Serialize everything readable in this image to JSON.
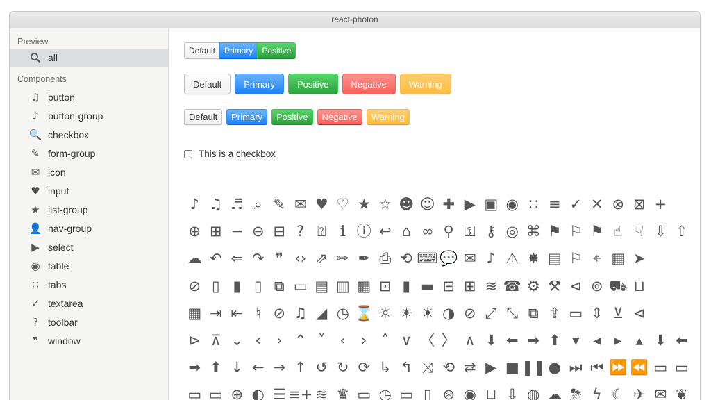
{
  "window": {
    "title": "react-photon"
  },
  "sidebar": {
    "preview_title": "Preview",
    "preview_item": {
      "label": "all",
      "icon": "search-icon"
    },
    "components_title": "Components",
    "items": [
      {
        "label": "button",
        "icon": "music-note-icon",
        "glyph": "♫"
      },
      {
        "label": "button-group",
        "icon": "music-note-icon",
        "glyph": "♪"
      },
      {
        "label": "checkbox",
        "icon": "search-icon",
        "glyph": "🔍"
      },
      {
        "label": "form-group",
        "icon": "mic-icon",
        "glyph": "✎"
      },
      {
        "label": "icon",
        "icon": "mail-icon",
        "glyph": "✉"
      },
      {
        "label": "input",
        "icon": "heart-icon",
        "glyph": "♥"
      },
      {
        "label": "list-group",
        "icon": "star-icon",
        "glyph": "★"
      },
      {
        "label": "nav-group",
        "icon": "user-icon",
        "glyph": "👤"
      },
      {
        "label": "select",
        "icon": "video-icon",
        "glyph": "▶"
      },
      {
        "label": "table",
        "icon": "camera-icon",
        "glyph": "◉"
      },
      {
        "label": "tabs",
        "icon": "grid-icon",
        "glyph": "∷"
      },
      {
        "label": "textarea",
        "icon": "check-icon",
        "glyph": "✓"
      },
      {
        "label": "toolbar",
        "icon": "help-icon",
        "glyph": "?"
      },
      {
        "label": "window",
        "icon": "quote-icon",
        "glyph": "❞"
      }
    ]
  },
  "buttons": {
    "group": [
      "Default",
      "Primary",
      "Positive"
    ],
    "large": [
      "Default",
      "Primary",
      "Positive",
      "Negative",
      "Warning"
    ],
    "mini": [
      "Default",
      "Primary",
      "Positive",
      "Negative",
      "Warning"
    ]
  },
  "checkbox": {
    "label": "This is a checkbox"
  },
  "colors": {
    "primary": "#1a82fb",
    "positive": "#29a03b",
    "negative": "#fc605b",
    "warning": "#fdbc40",
    "sidebar_bg": "#f5f5f4",
    "active_item_bg": "#dcdfe1"
  },
  "icons": [
    [
      "note-icon",
      "♪"
    ],
    [
      "note-beamed-icon",
      "♫"
    ],
    [
      "music-icon",
      "♬"
    ],
    [
      "search-icon",
      "⌕"
    ],
    [
      "mic-icon",
      "✎"
    ],
    [
      "mail-icon",
      "✉"
    ],
    [
      "heart-icon",
      "♥"
    ],
    [
      "heart-empty-icon",
      "♡"
    ],
    [
      "star-icon",
      "★"
    ],
    [
      "star-empty-icon",
      "☆"
    ],
    [
      "user-icon",
      "☻"
    ],
    [
      "users-icon",
      "☺"
    ],
    [
      "user-add-icon",
      "✚"
    ],
    [
      "video-icon",
      "▶"
    ],
    [
      "picture-icon",
      "▣"
    ],
    [
      "camera-icon",
      "◉"
    ],
    [
      "layout-icon",
      "∷"
    ],
    [
      "menu-icon",
      "≡"
    ],
    [
      "check-icon",
      "✓"
    ],
    [
      "cancel-icon",
      "✕"
    ],
    [
      "cancel-circled-icon",
      "⊗"
    ],
    [
      "cancel-squared-icon",
      "⊠"
    ],
    [
      "plus-icon",
      "+"
    ],
    [
      "blank-icon",
      " "
    ],
    [
      "plus-circled-icon",
      "⊕"
    ],
    [
      "plus-squared-icon",
      "⊞"
    ],
    [
      "minus-icon",
      "−"
    ],
    [
      "minus-circled-icon",
      "⊖"
    ],
    [
      "minus-squared-icon",
      "⊟"
    ],
    [
      "help-icon",
      "?"
    ],
    [
      "help-circled-icon",
      "⍰"
    ],
    [
      "info-icon",
      "ℹ"
    ],
    [
      "info-circled-icon",
      "ⓘ"
    ],
    [
      "back-icon",
      "↩"
    ],
    [
      "home-icon",
      "⌂"
    ],
    [
      "link-icon",
      "∞"
    ],
    [
      "attach-icon",
      "⚲"
    ],
    [
      "lock-icon",
      "⚿"
    ],
    [
      "lock-open-icon",
      "⚷"
    ],
    [
      "eye-icon",
      "◎"
    ],
    [
      "tag-icon",
      "⌘"
    ],
    [
      "bookmark-icon",
      "⚑"
    ],
    [
      "bookmarks-icon",
      "⚐"
    ],
    [
      "flag-icon",
      "⚑"
    ],
    [
      "thumbs-up-icon",
      "☝"
    ],
    [
      "thumbs-down-icon",
      "☟"
    ],
    [
      "download-icon",
      "⇩"
    ],
    [
      "upload-icon",
      "⇧"
    ],
    [
      "upload-cloud-icon",
      "☁"
    ],
    [
      "reply-icon",
      "↶"
    ],
    [
      "reply-all-icon",
      "⇐"
    ],
    [
      "forward-icon",
      "↷"
    ],
    [
      "quote-icon",
      "❞"
    ],
    [
      "code-icon",
      "‹›"
    ],
    [
      "export-icon",
      "⇗"
    ],
    [
      "pencil-icon",
      "✏"
    ],
    [
      "feather-icon",
      "✒"
    ],
    [
      "print-icon",
      "⎙"
    ],
    [
      "retweet-icon",
      "⟲"
    ],
    [
      "keyboard-icon",
      "⌨"
    ],
    [
      "comment-icon",
      "💬"
    ],
    [
      "chat-icon",
      "✉"
    ],
    [
      "bell-icon",
      "♪"
    ],
    [
      "attention-icon",
      "⚠"
    ],
    [
      "alert-icon",
      "✸"
    ],
    [
      "vcard-icon",
      "▤"
    ],
    [
      "address-icon",
      "⚐"
    ],
    [
      "location-icon",
      "⌖"
    ],
    [
      "map-icon",
      "▦"
    ],
    [
      "direction-icon",
      "➤"
    ],
    [
      "blank2-icon",
      " "
    ],
    [
      "blank3-icon",
      " "
    ],
    [
      "compass-icon",
      "⊘"
    ],
    [
      "trash-icon",
      "▯"
    ],
    [
      "trash-full-icon",
      "▮"
    ],
    [
      "doc-icon",
      "▯"
    ],
    [
      "docs-icon",
      "⧉"
    ],
    [
      "doc-landscape-icon",
      "▭"
    ],
    [
      "doc-text-icon",
      "▤"
    ],
    [
      "doc-text-inv-icon",
      "▥"
    ],
    [
      "newspaper-icon",
      "▦"
    ],
    [
      "book-open-icon",
      "⊡"
    ],
    [
      "book-icon",
      "▮"
    ],
    [
      "folder-icon",
      "▬"
    ],
    [
      "archive-icon",
      "⊟"
    ],
    [
      "box-icon",
      "⊞"
    ],
    [
      "rss-icon",
      "≋"
    ],
    [
      "phone-icon",
      "☎"
    ],
    [
      "cog-icon",
      "⚙"
    ],
    [
      "tools-icon",
      "⚒"
    ],
    [
      "share-icon",
      "⊲"
    ],
    [
      "shareable-icon",
      "⊚"
    ],
    [
      "basket-icon",
      "⛟"
    ],
    [
      "bag-icon",
      "⊔"
    ],
    [
      "blank4-icon",
      " "
    ],
    [
      "blank5-icon",
      " "
    ],
    [
      "calendar-icon",
      "▦"
    ],
    [
      "login-icon",
      "⇥"
    ],
    [
      "logout-icon",
      "⇤"
    ],
    [
      "mic-on-icon",
      "♮"
    ],
    [
      "mute-icon",
      "⊘"
    ],
    [
      "sound-icon",
      "♫"
    ],
    [
      "volume-icon",
      "◢"
    ],
    [
      "clock-icon",
      "◷"
    ],
    [
      "hourglass-icon",
      "⌛"
    ],
    [
      "lamp-icon",
      "☼"
    ],
    [
      "light-down-icon",
      "☀"
    ],
    [
      "light-up-icon",
      "☀"
    ],
    [
      "adjust-icon",
      "◑"
    ],
    [
      "block-icon",
      "⊘"
    ],
    [
      "resize-full-icon",
      "⤢"
    ],
    [
      "resize-small-icon",
      "⤡"
    ],
    [
      "popup-icon",
      "⧉"
    ],
    [
      "publish-icon",
      "⇪"
    ],
    [
      "window-icon",
      "▭"
    ],
    [
      "arrow-combo-icon",
      "⇕"
    ],
    [
      "down-circled-icon",
      "⊻"
    ],
    [
      "left-circled-icon",
      "⊲"
    ],
    [
      "blank6-icon",
      " "
    ],
    [
      "blank7-icon",
      " "
    ],
    [
      "right-circled-icon",
      "⊳"
    ],
    [
      "up-circled-icon",
      "⊼"
    ],
    [
      "down-open-icon",
      "⌄"
    ],
    [
      "left-open-icon",
      "‹"
    ],
    [
      "right-open-icon",
      "›"
    ],
    [
      "up-open-icon",
      "⌃"
    ],
    [
      "down-open-mini-icon",
      "˅"
    ],
    [
      "left-open-mini-icon",
      "‹"
    ],
    [
      "right-open-mini-icon",
      "›"
    ],
    [
      "up-open-mini-icon",
      "˄"
    ],
    [
      "down-open-big-icon",
      "∨"
    ],
    [
      "left-open-big-icon",
      "〈"
    ],
    [
      "right-open-big-icon",
      "〉"
    ],
    [
      "up-open-big-icon",
      "∧"
    ],
    [
      "down-icon",
      "⬇"
    ],
    [
      "left-icon",
      "⬅"
    ],
    [
      "right-icon",
      "➡"
    ],
    [
      "up-icon",
      "⬆"
    ],
    [
      "down-dir-icon",
      "▾"
    ],
    [
      "left-dir-icon",
      "◂"
    ],
    [
      "right-dir-icon",
      "▸"
    ],
    [
      "up-dir-icon",
      "▴"
    ],
    [
      "down-bold-icon",
      "⬇"
    ],
    [
      "left-bold-icon",
      "⬅"
    ],
    [
      "right-bold-icon",
      "➡"
    ],
    [
      "up-bold-icon",
      "⬆"
    ],
    [
      "down-thin-icon",
      "↓"
    ],
    [
      "left-thin-icon",
      "←"
    ],
    [
      "right-thin-icon",
      "→"
    ],
    [
      "up-thin-icon",
      "↑"
    ],
    [
      "ccw-icon",
      "↺"
    ],
    [
      "cw-icon",
      "↻"
    ],
    [
      "arrows-ccw-icon",
      "⟳"
    ],
    [
      "level-down-icon",
      "↳"
    ],
    [
      "level-up-icon",
      "↰"
    ],
    [
      "shuffle-icon",
      "⤨"
    ],
    [
      "loop-icon",
      "⟲"
    ],
    [
      "switch-icon",
      "⇄"
    ],
    [
      "play-icon",
      "▶"
    ],
    [
      "stop-icon",
      "■"
    ],
    [
      "pause-icon",
      "❚❚"
    ],
    [
      "record-icon",
      "●"
    ],
    [
      "to-end-icon",
      "⏭"
    ],
    [
      "to-start-icon",
      "⏮"
    ],
    [
      "fast-forward-icon",
      "⏩"
    ],
    [
      "fast-backward-icon",
      "⏪"
    ],
    [
      "progress-0-icon",
      "▭"
    ],
    [
      "progress-1-icon",
      "▭"
    ],
    [
      "progress-2-icon",
      "▭"
    ],
    [
      "progress-3-icon",
      "▭"
    ],
    [
      "target-icon",
      "⊕"
    ],
    [
      "palette-icon",
      "◐"
    ],
    [
      "list-icon",
      "☰"
    ],
    [
      "list-add-icon",
      "≡+"
    ],
    [
      "signal-icon",
      "≋"
    ],
    [
      "trophy-icon",
      "♛"
    ],
    [
      "battery-icon",
      "▭"
    ],
    [
      "back-in-time-icon",
      "◷"
    ],
    [
      "monitor-icon",
      "▭"
    ],
    [
      "mobile-icon",
      "▯"
    ],
    [
      "network-icon",
      "⊛"
    ],
    [
      "cd-icon",
      "◉"
    ],
    [
      "inbox-icon",
      "⊔"
    ],
    [
      "install-icon",
      "⇩"
    ],
    [
      "globe-icon",
      "◍"
    ],
    [
      "cloud-icon",
      "☁"
    ],
    [
      "cloud-thunder-icon",
      "⛈"
    ],
    [
      "flash-icon",
      "ϟ"
    ],
    [
      "moon-icon",
      "☾"
    ],
    [
      "flight-icon",
      "✈"
    ],
    [
      "paper-plane-icon",
      "✉"
    ],
    [
      "leaf-icon",
      "❦"
    ]
  ]
}
